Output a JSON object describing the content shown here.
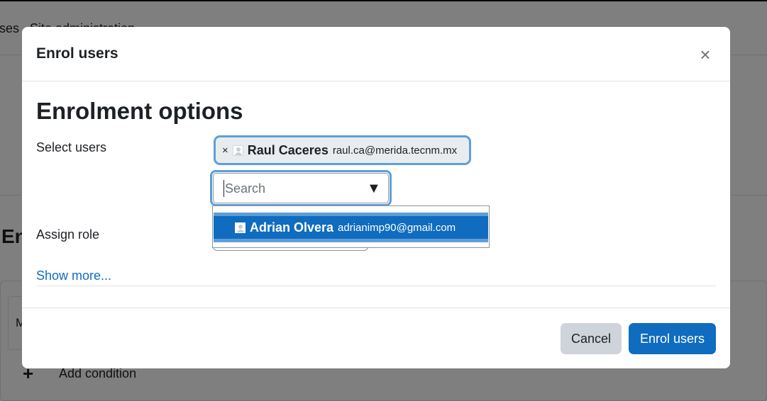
{
  "background": {
    "nav_items": [
      "ses",
      "Site administration"
    ],
    "heading": "En",
    "inner_text": "M",
    "add_condition_label": "Add condition"
  },
  "modal": {
    "title": "Enrol users",
    "section_title": "Enrolment options",
    "select_users_label": "Select users",
    "selected_user": {
      "name": "Raul Caceres",
      "email": "raul.ca@merida.tecnm.mx"
    },
    "search": {
      "placeholder": "Search",
      "value": ""
    },
    "suggestions": [
      {
        "name": "Adrian Olvera",
        "email": "adrianimp90@gmail.com",
        "highlighted": true
      }
    ],
    "assign_role_label": "Assign role",
    "show_more_label": "Show more...",
    "buttons": {
      "cancel": "Cancel",
      "enrol": "Enrol users"
    }
  },
  "colors": {
    "primary": "#0f6cbf",
    "focus_ring": "#5f9ed8",
    "secondary_button": "#ced4da"
  }
}
